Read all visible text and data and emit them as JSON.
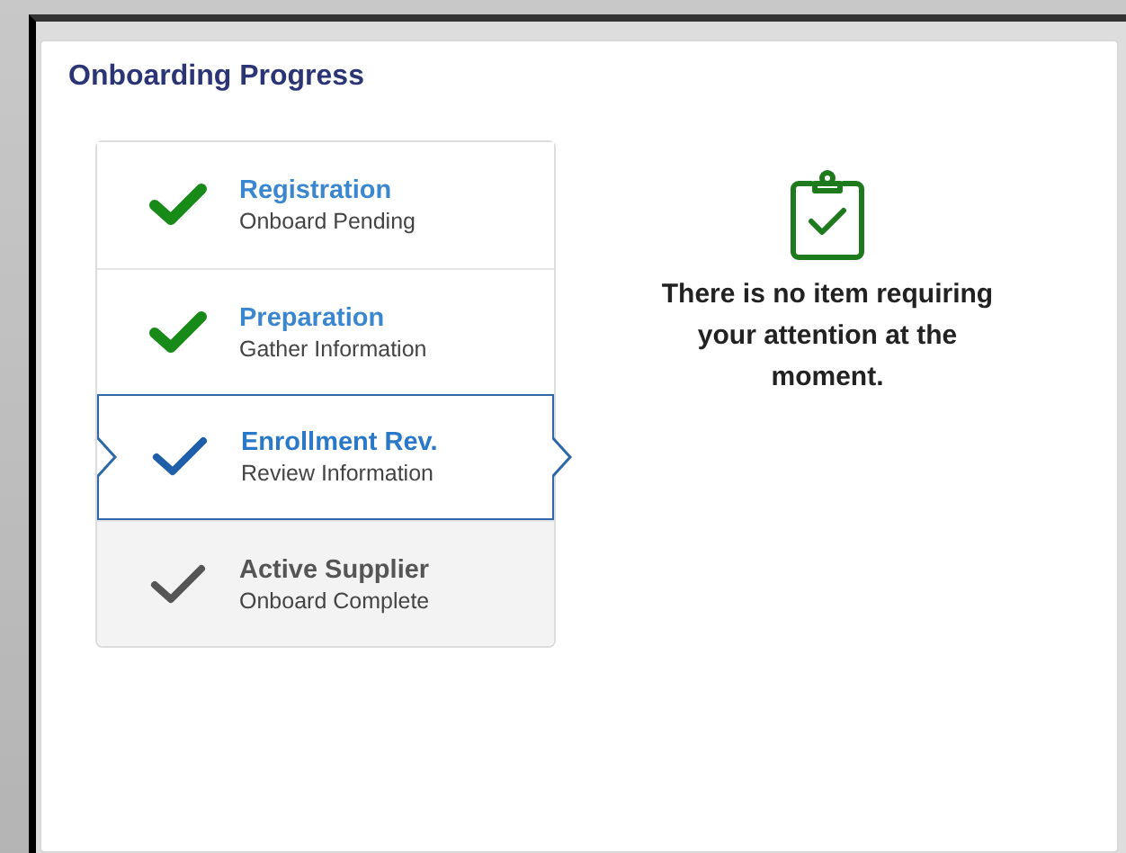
{
  "panel": {
    "title": "Onboarding Progress"
  },
  "steps": [
    {
      "title": "Registration",
      "subtitle": "Onboard Pending",
      "kind": "done",
      "selected": false
    },
    {
      "title": "Preparation",
      "subtitle": "Gather Information",
      "kind": "done",
      "selected": false
    },
    {
      "title": "Enrollment Rev.",
      "subtitle": "Review Information",
      "kind": "current",
      "selected": true
    },
    {
      "title": "Active Supplier",
      "subtitle": "Onboard Complete",
      "kind": "pending",
      "selected": false
    }
  ],
  "message": {
    "text": "There is no item requiring your attention at the moment."
  }
}
